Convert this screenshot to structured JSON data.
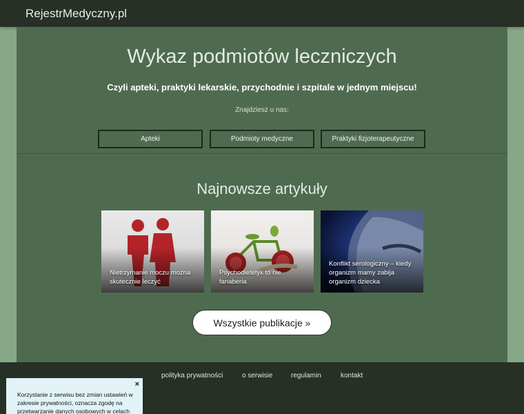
{
  "header": {
    "logo": "RejestrMedyczny.pl"
  },
  "hero": {
    "title": "Wykaz podmiotów leczniczych",
    "subtitle": "Czyli apteki, praktyki lekarskie, przychodnie i szpitale w jednym miejscu!",
    "find_label": "Znajdziesz u nas:",
    "categories": [
      "Apteki",
      "Podmioty medyczne",
      "Praktyki fizjoterapeutyczne"
    ]
  },
  "articles": {
    "title": "Najnowsze artykuły",
    "items": [
      {
        "caption": "Nietrzymanie moczu można skutecznie leczyć"
      },
      {
        "caption": "Psychodietetyk to nie fanaberia"
      },
      {
        "caption": "Konflikt serologiczny – kiedy organizm mamy zabija organizm dziecka"
      }
    ],
    "all_label": "Wszystkie publikacje »"
  },
  "footer": {
    "links": [
      "polityka prywatności",
      "o serwisie",
      "regulamin",
      "kontakt"
    ]
  },
  "cookie": {
    "text": "Korzystanie z serwisu bez zmian ustawień w zakresie prywatności, oznacza zgodę na przetwarzanie danych osobowych w celach",
    "close": "×"
  }
}
